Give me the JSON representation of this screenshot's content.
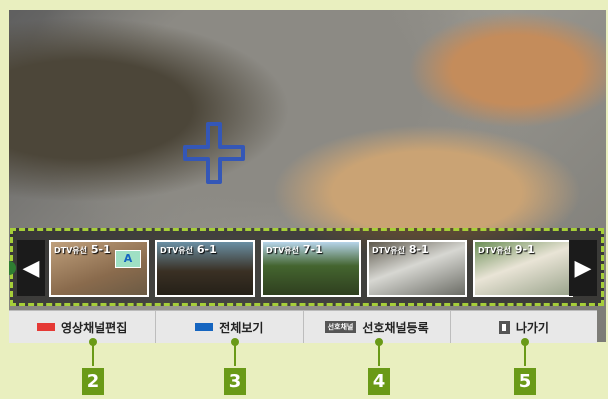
{
  "strip": {
    "thumbnails": [
      {
        "prefix": "DTV유선",
        "number": "5-1",
        "badge": "A"
      },
      {
        "prefix": "DTV유선",
        "number": "6-1"
      },
      {
        "prefix": "DTV유선",
        "number": "7-1"
      },
      {
        "prefix": "DTV유선",
        "number": "8-1"
      },
      {
        "prefix": "DTV유선",
        "number": "9-1"
      }
    ],
    "prev_icon": "◀",
    "next_icon": "▶"
  },
  "menu": {
    "items": [
      {
        "label": "영상채널편집",
        "icon": "red-key-icon",
        "color": "#e53935"
      },
      {
        "label": "전체보기",
        "icon": "blue-key-icon",
        "color": "#1565c0"
      },
      {
        "label": "선호채널등록",
        "icon": "favorite-key-icon",
        "icon_text": "선호채널"
      },
      {
        "label": "나가기",
        "icon": "exit-key-icon"
      }
    ]
  },
  "callouts": [
    "2",
    "3",
    "4",
    "5"
  ]
}
